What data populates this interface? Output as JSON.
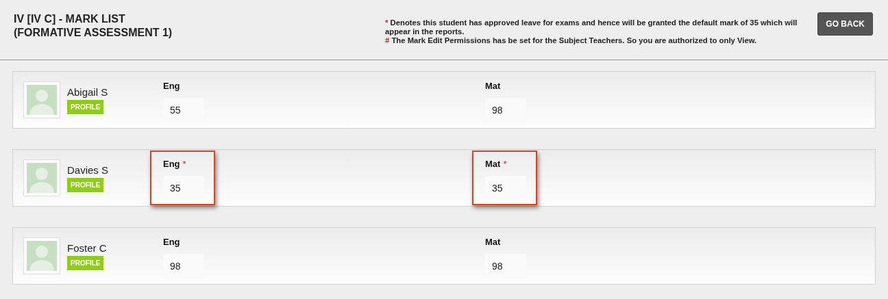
{
  "header": {
    "title_lines": [
      "IV [IV C] - MARK LIST",
      "(FORMATIVE ASSESSMENT 1)"
    ],
    "notes": [
      {
        "marker": "*",
        "text": "Denotes this student has approved leave for exams and hence will be granted the default mark of 35 which will appear in the reports."
      },
      {
        "marker": "#",
        "text": "The Mark Edit Permissions has be set for the Subject Teachers. So you are authorized to only View."
      }
    ],
    "back_button": "GO BACK"
  },
  "students": [
    {
      "name": "Abigail S",
      "profile_label": "PROFILE",
      "subjects": [
        {
          "label": "Eng",
          "value": "55",
          "highlighted": false
        },
        {
          "label": "Mat",
          "value": "98",
          "highlighted": false
        }
      ]
    },
    {
      "name": "Davies S",
      "profile_label": "PROFILE",
      "subjects": [
        {
          "label": "Eng",
          "marker": "*",
          "value": "35",
          "highlighted": true
        },
        {
          "label": "Mat",
          "marker": "*",
          "value": "35",
          "highlighted": true
        }
      ]
    },
    {
      "name": "Foster C",
      "profile_label": "PROFILE",
      "subjects": [
        {
          "label": "Eng",
          "value": "98",
          "highlighted": false
        },
        {
          "label": "Mat",
          "value": "98",
          "highlighted": false
        }
      ]
    }
  ]
}
